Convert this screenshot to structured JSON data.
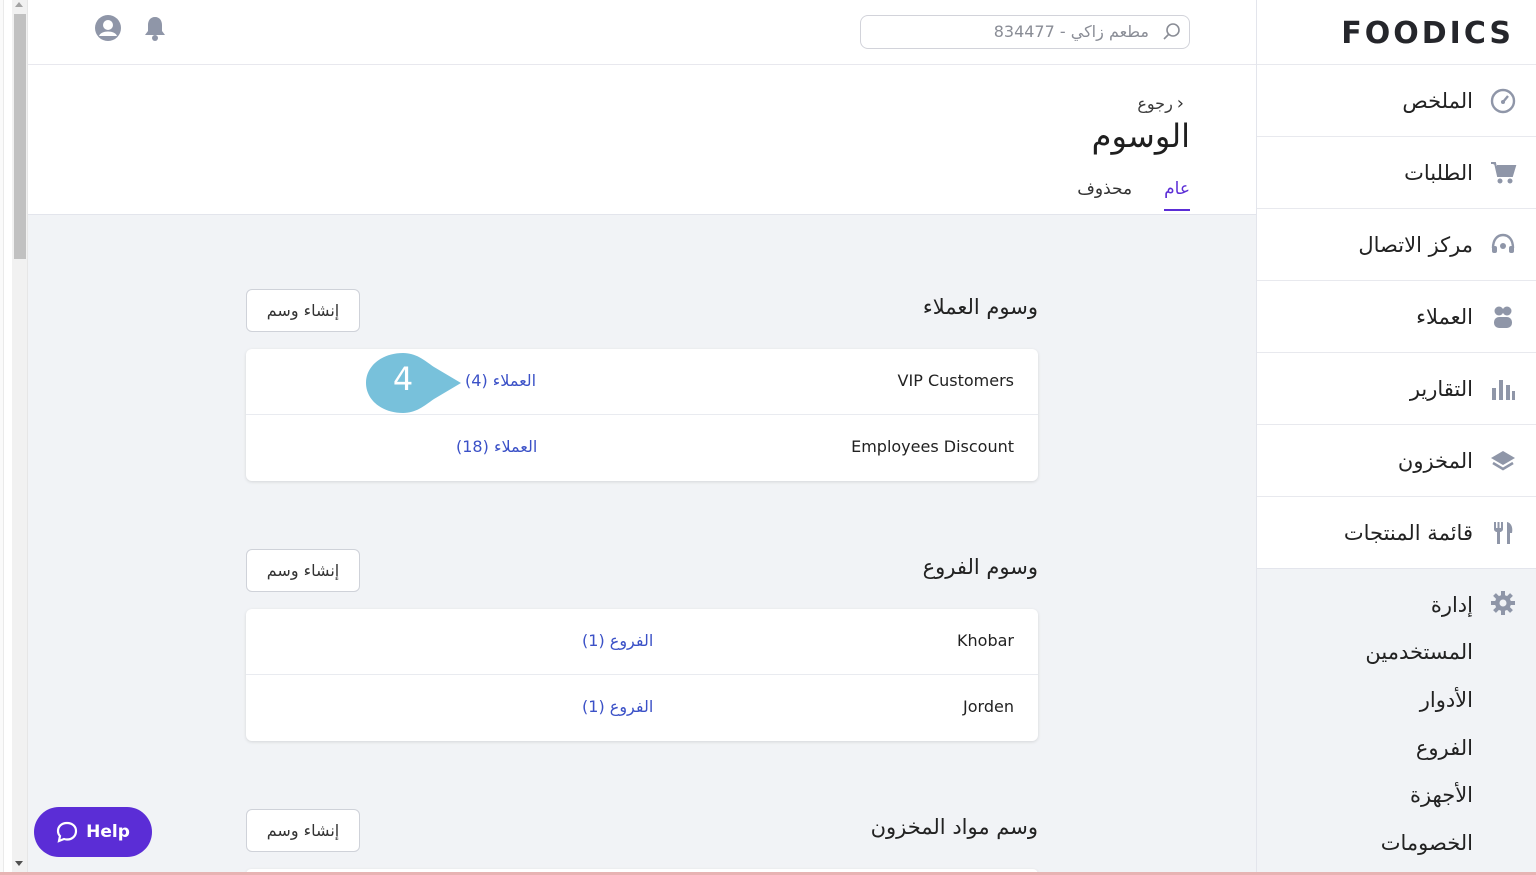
{
  "colors": {
    "accent": "#5b2dd6",
    "link": "#3b51c7",
    "icon": "#8f96a8",
    "callout": "#78c1db"
  },
  "search": {
    "placeholder": "مطعم زاكي - 834477"
  },
  "header": {
    "back_label": "رجوع",
    "title": "الوسوم",
    "tabs": [
      "عام",
      "محذوف"
    ],
    "active_tab": "عام"
  },
  "sections": [
    {
      "title": "وسوم العملاء",
      "create_label": "إنشاء وسم",
      "rows": [
        {
          "name": "VIP Customers",
          "link": "العملاء (4)"
        },
        {
          "name": "Employees Discount",
          "link": "العملاء (18)"
        }
      ]
    },
    {
      "title": "وسوم الفروع",
      "create_label": "إنشاء وسم",
      "rows": [
        {
          "name": "Khobar",
          "link": "الفروع (1)"
        },
        {
          "name": "Jorden",
          "link": "الفروع (1)"
        }
      ]
    },
    {
      "title": "وسم مواد المخزون",
      "create_label": "إنشاء وسم"
    }
  ],
  "callout": {
    "number": "4"
  },
  "help": {
    "label": "Help"
  },
  "sidebar": {
    "logo": "FOODICS",
    "items": [
      {
        "label": "الملخص",
        "icon": "dashboard-gauge-icon"
      },
      {
        "label": "الطلبات",
        "icon": "cart-icon"
      },
      {
        "label": "مركز الاتصال",
        "icon": "headset-icon"
      },
      {
        "label": "العملاء",
        "icon": "customers-icon"
      },
      {
        "label": "التقارير",
        "icon": "bar-chart-icon"
      },
      {
        "label": "المخزون",
        "icon": "layers-icon"
      },
      {
        "label": "قائمة المنتجات",
        "icon": "fork-knife-icon"
      }
    ],
    "admin": {
      "label": "إدارة",
      "icon": "gear-icon",
      "subitems": [
        "المستخدمين",
        "الأدوار",
        "الفروع",
        "الأجهزة",
        "الخصومات"
      ]
    }
  }
}
